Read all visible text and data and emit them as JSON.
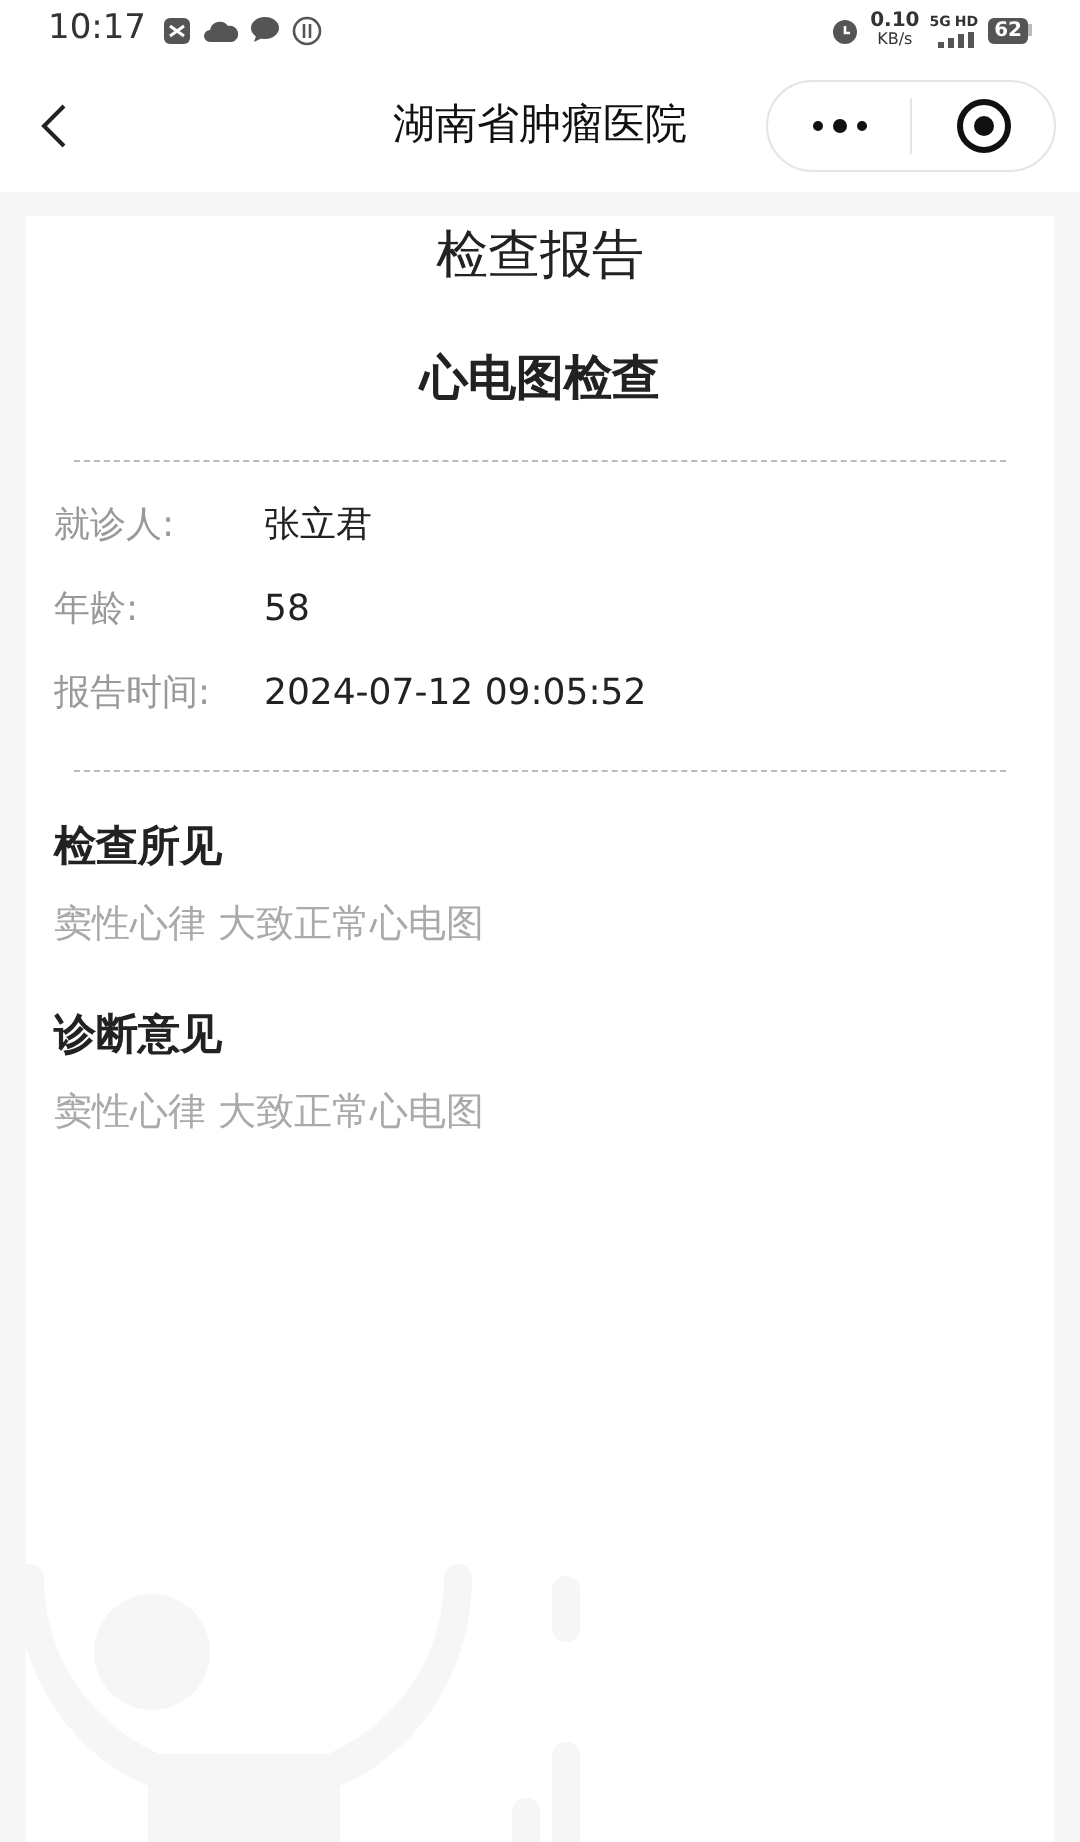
{
  "status_bar": {
    "time": "10:17",
    "speed": "0.10",
    "speed_unit": "KB/s",
    "network": "5G",
    "hd": "HD",
    "battery": "62"
  },
  "nav": {
    "title": "湖南省肿瘤医院"
  },
  "report": {
    "heading": "检查报告",
    "title": "心电图检查",
    "fields": [
      {
        "label": "就诊人:",
        "value": "张立君"
      },
      {
        "label": "年龄:",
        "value": "58"
      },
      {
        "label": "报告时间:",
        "value": "2024-07-12 09:05:52"
      }
    ],
    "sections": [
      {
        "heading": "检查所见",
        "text": "窦性心律 大致正常心电图"
      },
      {
        "heading": "诊断意见",
        "text": "窦性心律 大致正常心电图"
      }
    ]
  }
}
